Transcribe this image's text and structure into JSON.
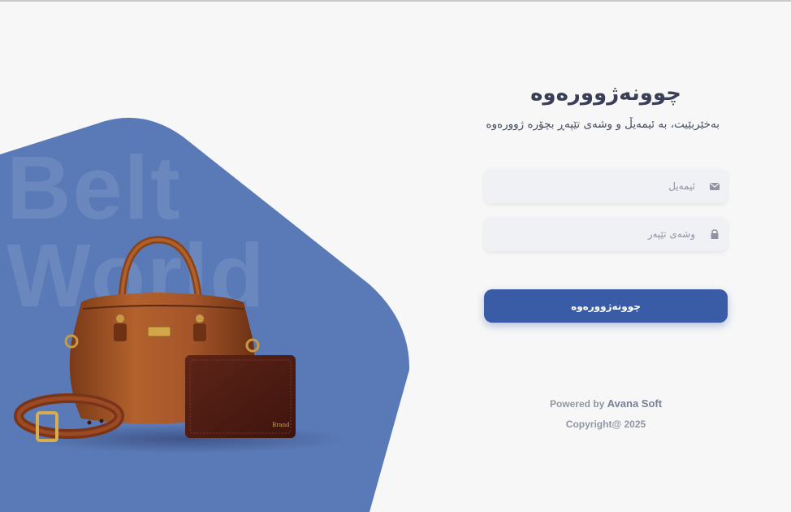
{
  "hero": {
    "watermark_line1": "Belt",
    "watermark_line2": "World",
    "shape_color": "#5a7ab7"
  },
  "login": {
    "title": "چوونەژوورەوە",
    "subtitle": "بەخێربێیت، بە ئیمەیڵ و وشەی تێپەڕ بچۆرە ژوورەوە",
    "email_placeholder": "ئیمەیل",
    "email_icon": "envelope-icon",
    "password_placeholder": "وشەی تێپەر",
    "password_icon": "lock-icon",
    "submit_label": "چوونەژوورەوە",
    "accent_color": "#3a5ba5"
  },
  "footer": {
    "powered_by": "Powered by",
    "company": "Avana Soft",
    "copyright": "Copyright@ 2025"
  }
}
